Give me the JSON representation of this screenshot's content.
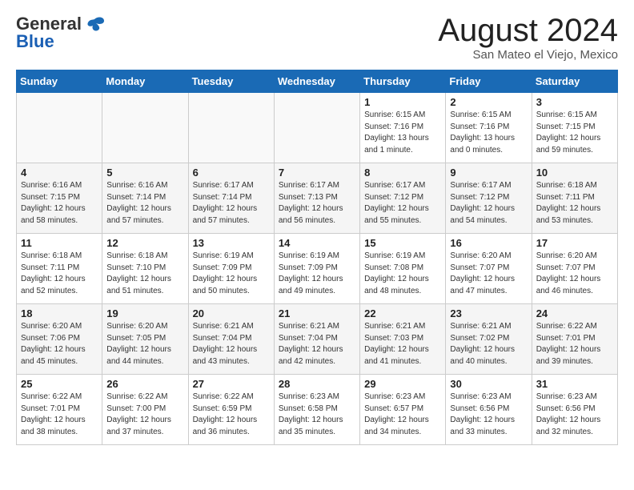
{
  "header": {
    "logo_line1": "General",
    "logo_line2": "Blue",
    "month_title": "August 2024",
    "location": "San Mateo el Viejo, Mexico"
  },
  "days_of_week": [
    "Sunday",
    "Monday",
    "Tuesday",
    "Wednesday",
    "Thursday",
    "Friday",
    "Saturday"
  ],
  "weeks": [
    [
      {
        "num": "",
        "info": ""
      },
      {
        "num": "",
        "info": ""
      },
      {
        "num": "",
        "info": ""
      },
      {
        "num": "",
        "info": ""
      },
      {
        "num": "1",
        "info": "Sunrise: 6:15 AM\nSunset: 7:16 PM\nDaylight: 13 hours\nand 1 minute."
      },
      {
        "num": "2",
        "info": "Sunrise: 6:15 AM\nSunset: 7:16 PM\nDaylight: 13 hours\nand 0 minutes."
      },
      {
        "num": "3",
        "info": "Sunrise: 6:15 AM\nSunset: 7:15 PM\nDaylight: 12 hours\nand 59 minutes."
      }
    ],
    [
      {
        "num": "4",
        "info": "Sunrise: 6:16 AM\nSunset: 7:15 PM\nDaylight: 12 hours\nand 58 minutes."
      },
      {
        "num": "5",
        "info": "Sunrise: 6:16 AM\nSunset: 7:14 PM\nDaylight: 12 hours\nand 57 minutes."
      },
      {
        "num": "6",
        "info": "Sunrise: 6:17 AM\nSunset: 7:14 PM\nDaylight: 12 hours\nand 57 minutes."
      },
      {
        "num": "7",
        "info": "Sunrise: 6:17 AM\nSunset: 7:13 PM\nDaylight: 12 hours\nand 56 minutes."
      },
      {
        "num": "8",
        "info": "Sunrise: 6:17 AM\nSunset: 7:12 PM\nDaylight: 12 hours\nand 55 minutes."
      },
      {
        "num": "9",
        "info": "Sunrise: 6:17 AM\nSunset: 7:12 PM\nDaylight: 12 hours\nand 54 minutes."
      },
      {
        "num": "10",
        "info": "Sunrise: 6:18 AM\nSunset: 7:11 PM\nDaylight: 12 hours\nand 53 minutes."
      }
    ],
    [
      {
        "num": "11",
        "info": "Sunrise: 6:18 AM\nSunset: 7:11 PM\nDaylight: 12 hours\nand 52 minutes."
      },
      {
        "num": "12",
        "info": "Sunrise: 6:18 AM\nSunset: 7:10 PM\nDaylight: 12 hours\nand 51 minutes."
      },
      {
        "num": "13",
        "info": "Sunrise: 6:19 AM\nSunset: 7:09 PM\nDaylight: 12 hours\nand 50 minutes."
      },
      {
        "num": "14",
        "info": "Sunrise: 6:19 AM\nSunset: 7:09 PM\nDaylight: 12 hours\nand 49 minutes."
      },
      {
        "num": "15",
        "info": "Sunrise: 6:19 AM\nSunset: 7:08 PM\nDaylight: 12 hours\nand 48 minutes."
      },
      {
        "num": "16",
        "info": "Sunrise: 6:20 AM\nSunset: 7:07 PM\nDaylight: 12 hours\nand 47 minutes."
      },
      {
        "num": "17",
        "info": "Sunrise: 6:20 AM\nSunset: 7:07 PM\nDaylight: 12 hours\nand 46 minutes."
      }
    ],
    [
      {
        "num": "18",
        "info": "Sunrise: 6:20 AM\nSunset: 7:06 PM\nDaylight: 12 hours\nand 45 minutes."
      },
      {
        "num": "19",
        "info": "Sunrise: 6:20 AM\nSunset: 7:05 PM\nDaylight: 12 hours\nand 44 minutes."
      },
      {
        "num": "20",
        "info": "Sunrise: 6:21 AM\nSunset: 7:04 PM\nDaylight: 12 hours\nand 43 minutes."
      },
      {
        "num": "21",
        "info": "Sunrise: 6:21 AM\nSunset: 7:04 PM\nDaylight: 12 hours\nand 42 minutes."
      },
      {
        "num": "22",
        "info": "Sunrise: 6:21 AM\nSunset: 7:03 PM\nDaylight: 12 hours\nand 41 minutes."
      },
      {
        "num": "23",
        "info": "Sunrise: 6:21 AM\nSunset: 7:02 PM\nDaylight: 12 hours\nand 40 minutes."
      },
      {
        "num": "24",
        "info": "Sunrise: 6:22 AM\nSunset: 7:01 PM\nDaylight: 12 hours\nand 39 minutes."
      }
    ],
    [
      {
        "num": "25",
        "info": "Sunrise: 6:22 AM\nSunset: 7:01 PM\nDaylight: 12 hours\nand 38 minutes."
      },
      {
        "num": "26",
        "info": "Sunrise: 6:22 AM\nSunset: 7:00 PM\nDaylight: 12 hours\nand 37 minutes."
      },
      {
        "num": "27",
        "info": "Sunrise: 6:22 AM\nSunset: 6:59 PM\nDaylight: 12 hours\nand 36 minutes."
      },
      {
        "num": "28",
        "info": "Sunrise: 6:23 AM\nSunset: 6:58 PM\nDaylight: 12 hours\nand 35 minutes."
      },
      {
        "num": "29",
        "info": "Sunrise: 6:23 AM\nSunset: 6:57 PM\nDaylight: 12 hours\nand 34 minutes."
      },
      {
        "num": "30",
        "info": "Sunrise: 6:23 AM\nSunset: 6:56 PM\nDaylight: 12 hours\nand 33 minutes."
      },
      {
        "num": "31",
        "info": "Sunrise: 6:23 AM\nSunset: 6:56 PM\nDaylight: 12 hours\nand 32 minutes."
      }
    ]
  ]
}
